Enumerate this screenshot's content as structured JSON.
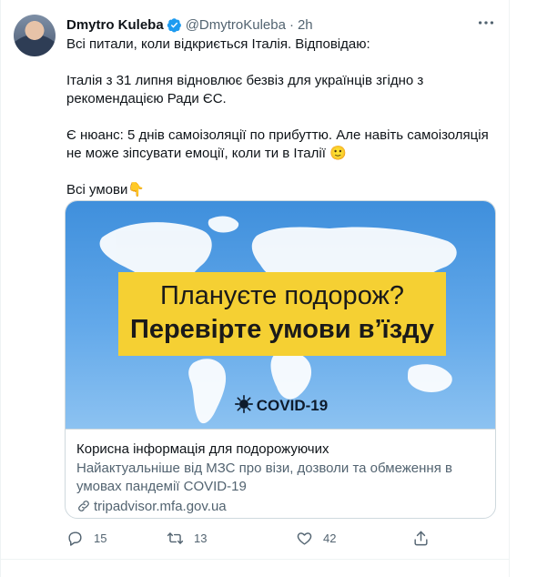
{
  "author": {
    "name": "Dmytro Kuleba",
    "handle": "@DmytroKuleba",
    "separator": "·",
    "time": "2h"
  },
  "tweet": {
    "line1": "Всі питали, коли відкриється Італія. Відповідаю:",
    "line2": "Італія з 31 липня відновлює безвіз для українців згідно з рекомендацією Ради ЄС.",
    "line3": "Є нюанс: 5 днів самоізоляції по прибуттю. Але навіть самоізоляція не може зіпсувати емоції, коли ти в Італії 🙂",
    "line4": "Всі умови👇"
  },
  "card": {
    "banner_line1": "Плануєте подорож?",
    "banner_line2": "Перевірте умови в’їзду",
    "badge": "COVID-19",
    "title": "Корисна інформація для подорожуючих",
    "description": "Найактуальніше від МЗС про візи, дозволи та обмеження в умовах пандемії COVID-19",
    "link": "tripadvisor.mfa.gov.ua"
  },
  "actions": {
    "reply_count": "15",
    "retweet_count": "13",
    "like_count": "42"
  },
  "colors": {
    "verified": "#1d9bf0",
    "banner": "#f5d033",
    "secondary_text": "#536471"
  },
  "icons": {
    "verified": "verified-badge-icon",
    "more": "more-dots-icon",
    "virus": "virus-icon",
    "link": "link-icon",
    "reply": "reply-icon",
    "retweet": "retweet-icon",
    "like": "heart-icon",
    "share": "share-icon"
  }
}
